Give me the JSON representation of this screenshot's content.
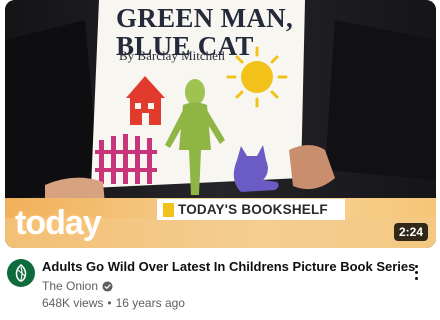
{
  "video": {
    "title": "Adults Go Wild Over Latest In Childrens Picture Book Series",
    "duration": "2:24",
    "views": "648K views",
    "separator": "•",
    "age": "16 years ago"
  },
  "channel": {
    "name": "The Onion",
    "verified": true,
    "avatar_icon": "onion-logo-icon"
  },
  "thumbnail": {
    "book_title_line1": "GREEN MAN,",
    "book_title_line2": "BLUE CAT",
    "book_author": "By Barclay Mitchell",
    "lower_third": "TODAY'S BOOKSHELF",
    "logo_text": "today"
  },
  "colors": {
    "accent_green": "#0d6b3e",
    "sun_yellow": "#f3c21a",
    "house_red": "#e23b2e",
    "fence_pink": "#c8357a",
    "cat_purple": "#6a5cc4"
  },
  "icons": {
    "more": "vertical-ellipsis-icon",
    "verified": "verified-check-icon"
  }
}
